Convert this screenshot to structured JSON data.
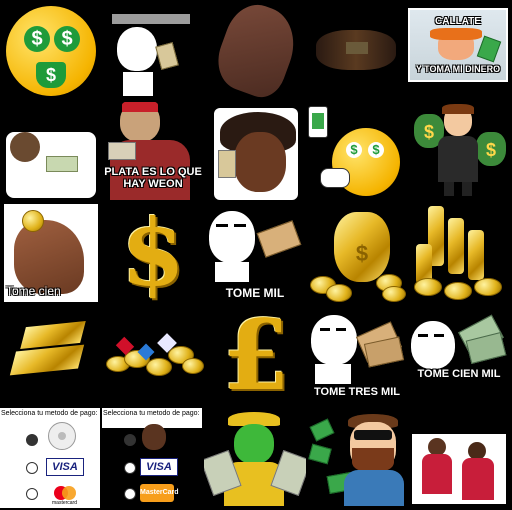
{
  "stickers": {
    "callate_top": "CALLATE",
    "callate_bottom": "Y TOMA MI DINERO",
    "plata": "PLATA ES LO QUE HAY WEON",
    "tome_cien_1": "Tome cien",
    "tome_mil": "TOME MIL",
    "tome_tres_mil": "TOME TRES MIL",
    "tome_cien_mil": "TOME CIEN MIL",
    "pay_label_1": "Selecciona tu metodo de pago:",
    "pay_label_2": "Selecciona tu metodo de pago:",
    "visa": "VISA",
    "mastercard": "mastercard",
    "mastercard_2": "MasterCard",
    "dollar": "$",
    "pound": "£"
  }
}
